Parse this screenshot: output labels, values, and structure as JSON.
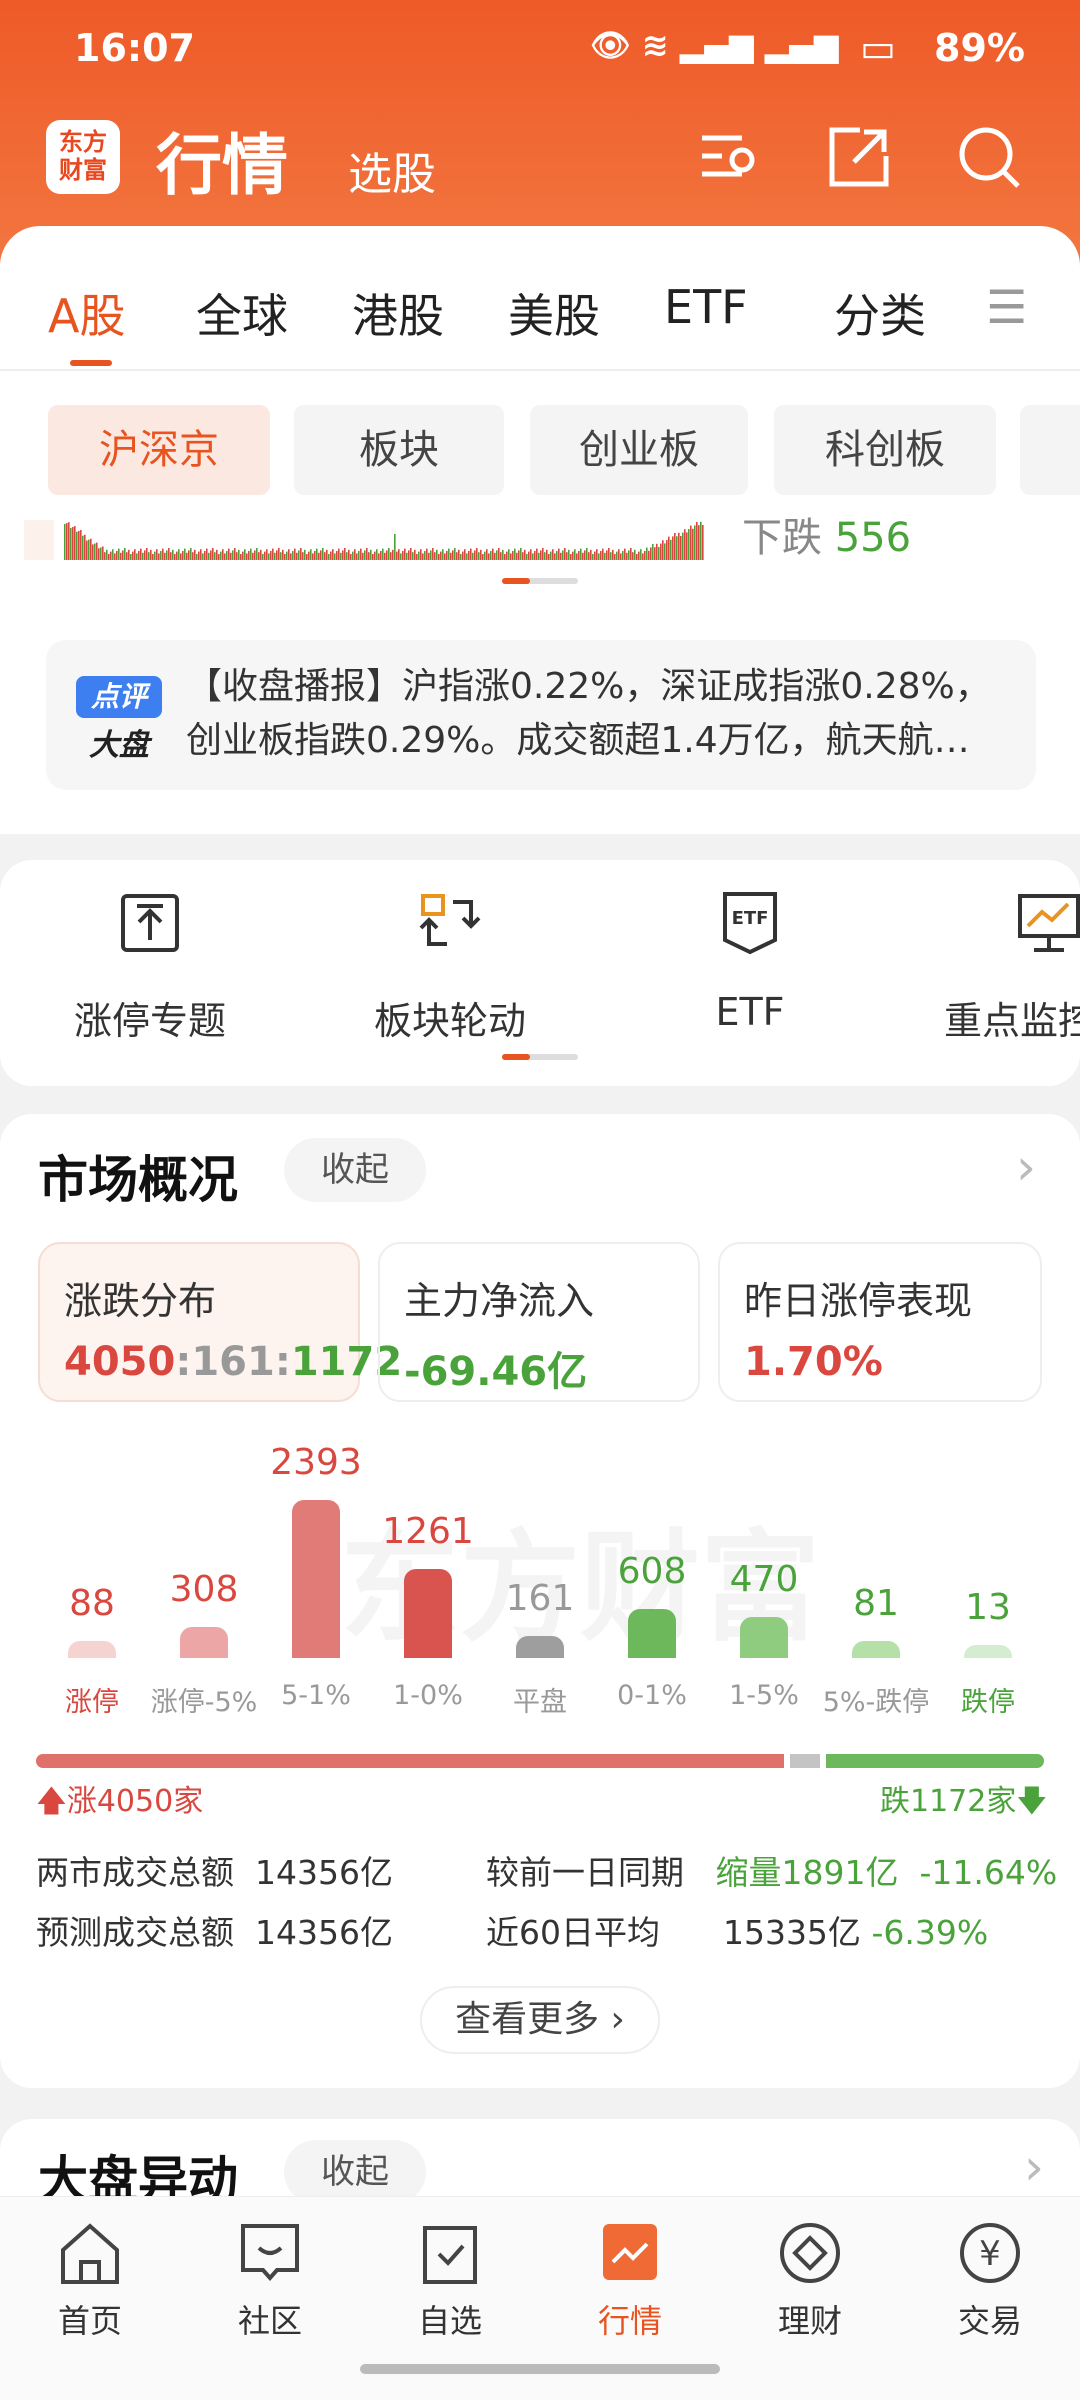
{
  "status_bar": {
    "time": "16:07",
    "battery": "89%"
  },
  "header": {
    "logo": "东方财富",
    "title": "行情",
    "subtitle": "选股"
  },
  "market_tabs": [
    {
      "label": "A股",
      "active": true
    },
    {
      "label": "全球"
    },
    {
      "label": "港股"
    },
    {
      "label": "美股"
    },
    {
      "label": "ETF"
    },
    {
      "label": "分类"
    }
  ],
  "sub_tabs": [
    {
      "label": "沪深京",
      "active": true
    },
    {
      "label": "板块"
    },
    {
      "label": "创业板"
    },
    {
      "label": "科创板"
    }
  ],
  "mini_chart": {
    "label": "下跌",
    "value": "556"
  },
  "news": {
    "badge_top": "点评",
    "badge_bottom": "大盘",
    "line1": "【收盘播报】沪指涨0.22%，深证成指涨0.28%，",
    "line2": "创业板指跌0.29%。成交额超1.4万亿，航天航…"
  },
  "shortcuts": [
    {
      "label": "涨停专题",
      "icon": "limit-up-icon"
    },
    {
      "label": "板块轮动",
      "icon": "rotation-icon"
    },
    {
      "label": "ETF",
      "icon": "etf-icon"
    },
    {
      "label": "重点监控",
      "icon": "monitor-icon"
    }
  ],
  "market_overview": {
    "title": "市场概况",
    "collapse": "收起",
    "boxes": [
      {
        "label": "涨跌分布",
        "up": "4050",
        "flat": "161",
        "down": "1172"
      },
      {
        "label": "主力净流入",
        "value": "-69.46亿"
      },
      {
        "label": "昨日涨停表现",
        "value": "1.70%"
      }
    ],
    "watermark": "东方财富",
    "up_label": "涨4050家",
    "down_label": "跌1172家",
    "stats": [
      {
        "label": "两市成交总额",
        "value": "14356亿"
      },
      {
        "label": "较前一日同期",
        "value": "缩量1891亿",
        "change": "-11.64%"
      },
      {
        "label": "预测成交总额",
        "value": "14356亿"
      },
      {
        "label": "近60日平均",
        "value": "15335亿",
        "change": "-6.39%"
      }
    ],
    "more": "查看更多"
  },
  "chart_data": {
    "type": "bar",
    "categories": [
      "涨停",
      "涨停-5%",
      "5-1%",
      "1-0%",
      "平盘",
      "0-1%",
      "1-5%",
      "5%-跌停",
      "跌停"
    ],
    "values": [
      88,
      308,
      2393,
      1261,
      161,
      608,
      470,
      81,
      13
    ],
    "colors": [
      "#f5d3d1",
      "#eba6a5",
      "#e07b78",
      "#d9534f",
      "#9e9e9e",
      "#6cb85a",
      "#8fcc7f",
      "#b5e0a8",
      "#d4ecd0"
    ]
  },
  "next_section": {
    "title": "大盘异动",
    "collapse": "收起"
  },
  "bottom_nav": [
    {
      "label": "首页"
    },
    {
      "label": "社区"
    },
    {
      "label": "自选"
    },
    {
      "label": "行情",
      "active": true
    },
    {
      "label": "理财"
    },
    {
      "label": "交易"
    }
  ]
}
